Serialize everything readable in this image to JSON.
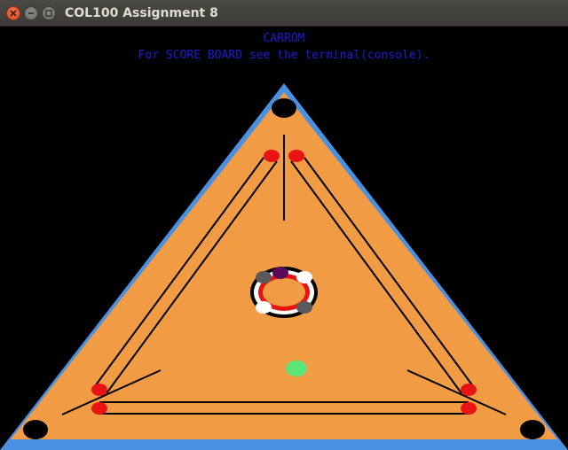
{
  "window": {
    "title": "COL100 Assignment 8",
    "buttons": [
      {
        "name": "close-button",
        "icon": "close-icon"
      },
      {
        "name": "minimize-button",
        "icon": "minimize-icon"
      },
      {
        "name": "maximize-button",
        "icon": "maximize-icon"
      }
    ]
  },
  "game": {
    "title": "CARROM",
    "subtitle": "For SCORE BOARD see the terminal(console).",
    "colors": {
      "background": "#000000",
      "board": "#f19c45",
      "border": "#4a90e0",
      "pocket": "#000000",
      "base_circle": "#e81414",
      "striker": "#5ee37a",
      "coin_white": "#ffffff",
      "coin_black": "#5a5a5a",
      "queen": "#5a0a5a",
      "lines": "#000000",
      "heading_text": "#1d1dd6"
    },
    "coins": [
      {
        "type": "queen",
        "color": "#5a0a5a"
      },
      {
        "type": "white",
        "color": "#ffffff"
      },
      {
        "type": "black",
        "color": "#5a5a5a"
      },
      {
        "type": "white",
        "color": "#ffffff"
      },
      {
        "type": "black",
        "color": "#5a5a5a"
      },
      {
        "type": "white",
        "color": "#ffffff"
      },
      {
        "type": "black",
        "color": "#5a5a5a"
      }
    ],
    "striker": {
      "color": "#5ee37a"
    }
  }
}
